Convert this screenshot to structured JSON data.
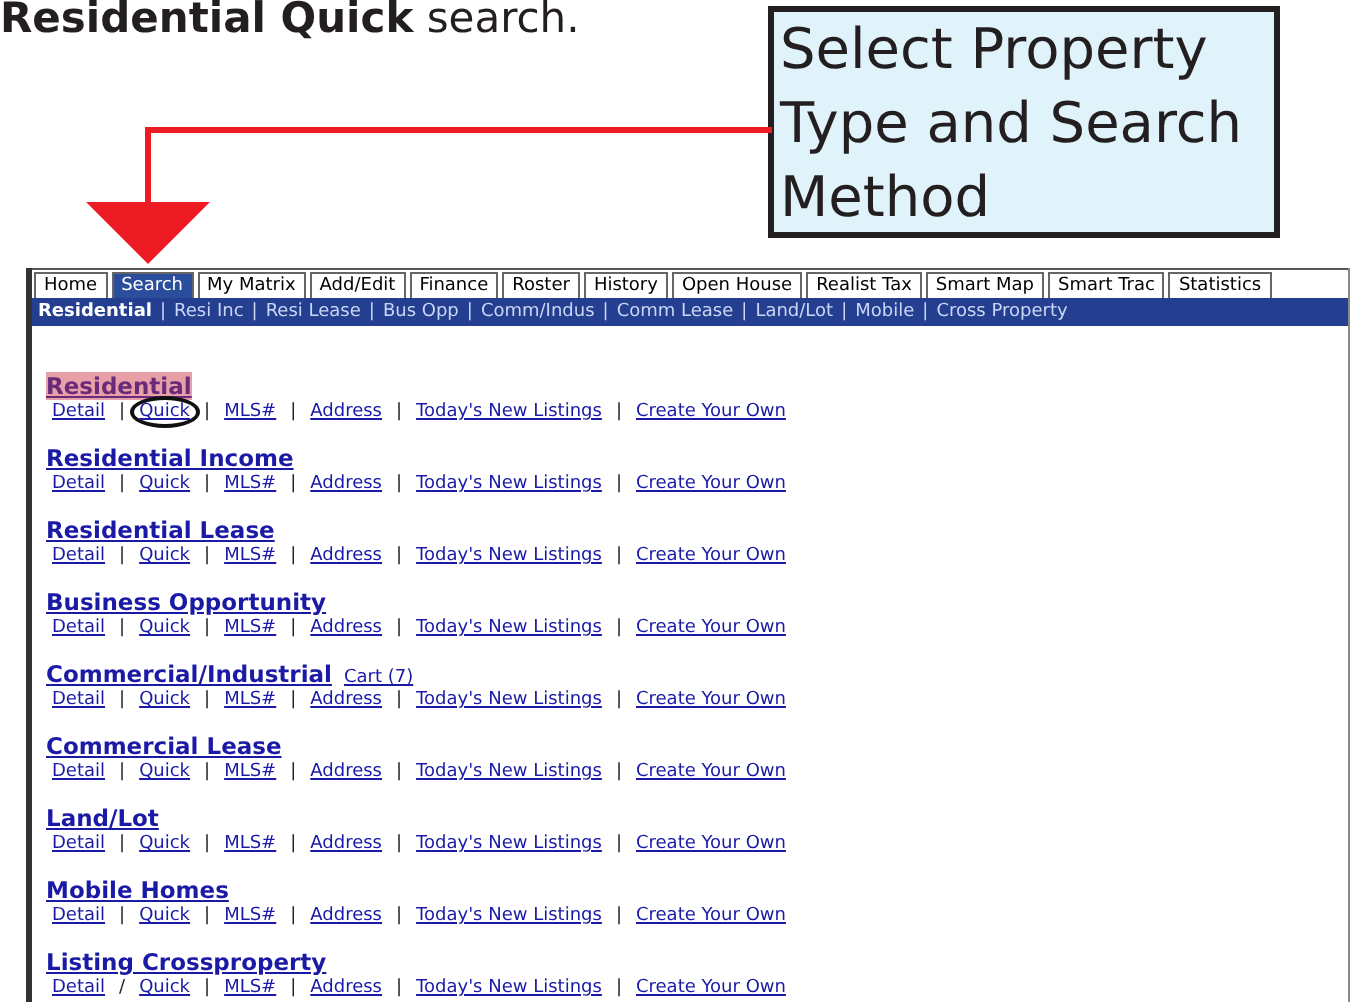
{
  "caption": "**Residential Quick** search.",
  "callout": {
    "text": "Select Property Type and Search Method"
  },
  "tabs": [
    {
      "label": "Home",
      "selected": false
    },
    {
      "label": "Search",
      "selected": true
    },
    {
      "label": "My Matrix",
      "selected": false
    },
    {
      "label": "Add/Edit",
      "selected": false
    },
    {
      "label": "Finance",
      "selected": false
    },
    {
      "label": "Roster",
      "selected": false
    },
    {
      "label": "History",
      "selected": false
    },
    {
      "label": "Open House",
      "selected": false
    },
    {
      "label": "Realist Tax",
      "selected": false
    },
    {
      "label": "Smart Map",
      "selected": false
    },
    {
      "label": "Smart Trac",
      "selected": false
    },
    {
      "label": "Statistics",
      "selected": false
    }
  ],
  "subnav": {
    "separator": "|",
    "items": [
      {
        "label": "Residential",
        "selected": true
      },
      {
        "label": "Resi Inc",
        "selected": false
      },
      {
        "label": "Resi Lease",
        "selected": false
      },
      {
        "label": "Bus Opp",
        "selected": false
      },
      {
        "label": "Comm/Indus",
        "selected": false
      },
      {
        "label": "Comm Lease",
        "selected": false
      },
      {
        "label": "Land/Lot",
        "selected": false
      },
      {
        "label": "Mobile",
        "selected": false
      },
      {
        "label": "Cross Property",
        "selected": false
      }
    ]
  },
  "sections": [
    {
      "title": "Residential",
      "highlighted": true,
      "links": [
        {
          "label": "Detail",
          "sep": "|",
          "circled": false
        },
        {
          "label": "Quick",
          "sep": "|",
          "circled": true
        },
        {
          "label": "MLS#",
          "sep": "|",
          "circled": false
        },
        {
          "label": "Address",
          "sep": "|",
          "circled": false
        },
        {
          "label": "Today's New Listings",
          "sep": "|",
          "circled": false
        },
        {
          "label": "Create Your Own",
          "circled": false
        }
      ]
    },
    {
      "title": "Residential Income",
      "highlighted": false,
      "links": [
        {
          "label": "Detail",
          "sep": "|",
          "circled": false
        },
        {
          "label": "Quick",
          "sep": "|",
          "circled": false
        },
        {
          "label": "MLS#",
          "sep": "|",
          "circled": false
        },
        {
          "label": "Address",
          "sep": "|",
          "circled": false
        },
        {
          "label": "Today's New Listings",
          "sep": "|",
          "circled": false
        },
        {
          "label": "Create Your Own",
          "circled": false
        }
      ]
    },
    {
      "title": "Residential Lease",
      "highlighted": false,
      "links": [
        {
          "label": "Detail",
          "sep": "|",
          "circled": false
        },
        {
          "label": "Quick",
          "sep": "|",
          "circled": false
        },
        {
          "label": "MLS#",
          "sep": "|",
          "circled": false
        },
        {
          "label": "Address",
          "sep": "|",
          "circled": false
        },
        {
          "label": "Today's New Listings",
          "sep": "|",
          "circled": false
        },
        {
          "label": "Create Your Own",
          "circled": false
        }
      ]
    },
    {
      "title": "Business Opportunity",
      "highlighted": false,
      "links": [
        {
          "label": "Detail",
          "sep": "|",
          "circled": false
        },
        {
          "label": "Quick",
          "sep": "|",
          "circled": false
        },
        {
          "label": "MLS#",
          "sep": "|",
          "circled": false
        },
        {
          "label": "Address",
          "sep": "|",
          "circled": false
        },
        {
          "label": "Today's New Listings",
          "sep": "|",
          "circled": false
        },
        {
          "label": "Create Your Own",
          "circled": false
        }
      ]
    },
    {
      "title": "Commercial/Industrial",
      "highlighted": false,
      "cart": "Cart (7)",
      "links": [
        {
          "label": "Detail",
          "sep": "|",
          "circled": false
        },
        {
          "label": "Quick",
          "sep": "|",
          "circled": false
        },
        {
          "label": "MLS#",
          "sep": "|",
          "circled": false
        },
        {
          "label": "Address",
          "sep": "|",
          "circled": false
        },
        {
          "label": "Today's New Listings",
          "sep": "|",
          "circled": false
        },
        {
          "label": "Create Your Own",
          "circled": false
        }
      ]
    },
    {
      "title": "Commercial Lease",
      "highlighted": false,
      "links": [
        {
          "label": "Detail",
          "sep": "|",
          "circled": false
        },
        {
          "label": "Quick",
          "sep": "|",
          "circled": false
        },
        {
          "label": "MLS#",
          "sep": "|",
          "circled": false
        },
        {
          "label": "Address",
          "sep": "|",
          "circled": false
        },
        {
          "label": "Today's New Listings",
          "sep": "|",
          "circled": false
        },
        {
          "label": "Create Your Own",
          "circled": false
        }
      ]
    },
    {
      "title": "Land/Lot",
      "highlighted": false,
      "links": [
        {
          "label": "Detail",
          "sep": "|",
          "circled": false
        },
        {
          "label": "Quick",
          "sep": "|",
          "circled": false
        },
        {
          "label": "MLS#",
          "sep": "|",
          "circled": false
        },
        {
          "label": "Address",
          "sep": "|",
          "circled": false
        },
        {
          "label": "Today's New Listings",
          "sep": "|",
          "circled": false
        },
        {
          "label": "Create Your Own",
          "circled": false
        }
      ]
    },
    {
      "title": "Mobile Homes",
      "highlighted": false,
      "links": [
        {
          "label": "Detail",
          "sep": "|",
          "circled": false
        },
        {
          "label": "Quick",
          "sep": "|",
          "circled": false
        },
        {
          "label": "MLS#",
          "sep": "|",
          "circled": false
        },
        {
          "label": "Address",
          "sep": "|",
          "circled": false
        },
        {
          "label": "Today's New Listings",
          "sep": "|",
          "circled": false
        },
        {
          "label": "Create Your Own",
          "circled": false
        }
      ]
    },
    {
      "title": "Listing Crossproperty",
      "highlighted": false,
      "links": [
        {
          "label": "Detail",
          "sep": "/",
          "circled": false
        },
        {
          "label": "Quick",
          "sep": "|",
          "circled": false
        },
        {
          "label": "MLS#",
          "sep": "|",
          "circled": false
        },
        {
          "label": "Address",
          "sep": "|",
          "circled": false
        },
        {
          "label": "Today's New Listings",
          "sep": "|",
          "circled": false
        },
        {
          "label": "Create Your Own",
          "circled": false
        }
      ]
    }
  ]
}
